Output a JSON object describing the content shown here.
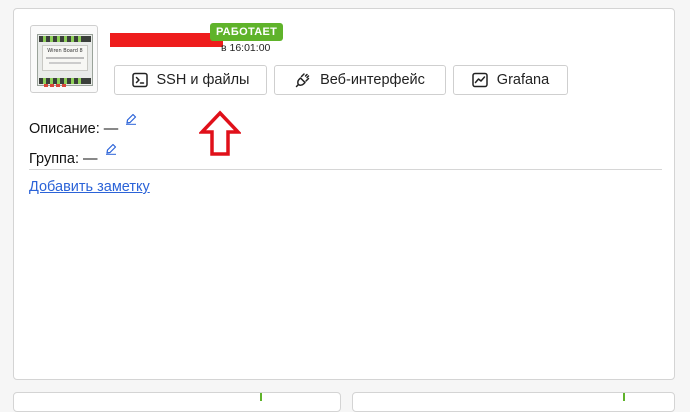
{
  "device": {
    "brand_label": "Wiren Board 8",
    "status": "РАБОТАЕТ",
    "status_time": "в 16:01:00",
    "status_color": "#5fb32a",
    "name_redaction_color": "#ee1c1c"
  },
  "actions": {
    "ssh": {
      "label": "SSH и файлы",
      "icon": "terminal-icon"
    },
    "web": {
      "label": "Веб-интерфейс",
      "icon": "plug-icon"
    },
    "grafana": {
      "label": "Grafana",
      "icon": "chart-icon"
    }
  },
  "meta": {
    "description_label": "Описание:",
    "description_value": "—",
    "group_label": "Группа:",
    "group_value": "—",
    "edit_icon": "pencil-icon"
  },
  "add_note_link": "Добавить заметку",
  "annotation": {
    "type": "arrow-up",
    "color": "#e0101a"
  },
  "colors": {
    "link": "#2b63d8",
    "border": "#cfcfcf"
  }
}
